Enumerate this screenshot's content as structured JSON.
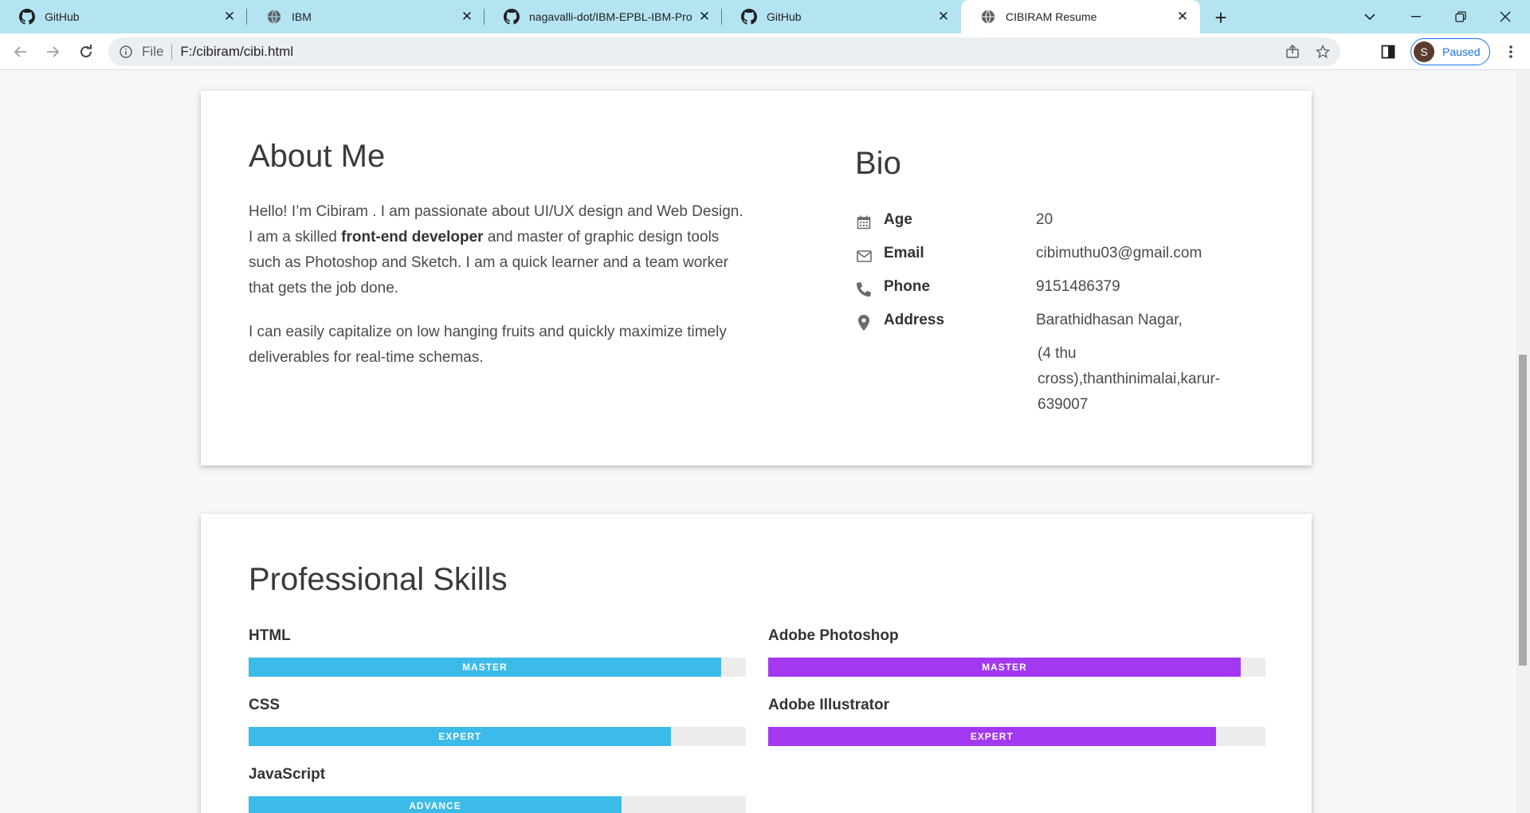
{
  "browser": {
    "tabs": [
      {
        "title": "GitHub",
        "icon": "github-icon",
        "active": false
      },
      {
        "title": "IBM",
        "icon": "globe-icon",
        "active": false
      },
      {
        "title": "nagavalli-dot/IBM-EPBL-IBM-Pro",
        "icon": "github-icon",
        "active": false
      },
      {
        "title": "GitHub",
        "icon": "github-icon",
        "active": false
      },
      {
        "title": "CIBIRAM Resume",
        "icon": "globe-icon",
        "active": true
      }
    ],
    "address": {
      "scheme": "File",
      "url": "F:/cibiram/cibi.html"
    },
    "profile": {
      "initial": "S",
      "status": "Paused"
    },
    "colors": {
      "tabstrip": "#b4e4f1",
      "accent": "#1a73e8"
    }
  },
  "about": {
    "title": "About Me",
    "p1_pre": "Hello! I’m Cibiram . I am passionate about UI/UX design and Web Design. I am a skilled ",
    "p1_bold": "front-end developer",
    "p1_post": " and master of graphic design tools such as Photoshop and Sketch. I am a quick learner and a team worker that gets the job done.",
    "p2": "I can easily capitalize on low hanging fruits and quickly maximize timely deliverables for real-time schemas."
  },
  "bio": {
    "title": "Bio",
    "rows": [
      {
        "label": "Age",
        "value": "20",
        "icon": "calendar-icon"
      },
      {
        "label": "Email",
        "value": "cibimuthu03@gmail.com",
        "icon": "envelope-icon"
      },
      {
        "label": "Phone",
        "value": "9151486379",
        "icon": "phone-icon"
      },
      {
        "label": "Address",
        "value": "Barathidhasan Nagar,",
        "icon": "map-marker-icon"
      }
    ],
    "address_extra": "(4 thu cross),thanthinimalai,karur-639007"
  },
  "skills": {
    "title": "Professional Skills",
    "colors": {
      "left": "#3cbbe8",
      "right": "#a238f0"
    },
    "items": [
      {
        "name": "HTML",
        "level": "MASTER",
        "percent": 95
      },
      {
        "name": "CSS",
        "level": "EXPERT",
        "percent": 85
      },
      {
        "name": "JavaScript",
        "level": "ADVANCE",
        "percent": 75
      },
      {
        "name": "Adobe Photoshop",
        "level": "MASTER",
        "percent": 95
      },
      {
        "name": "Adobe Illustrator",
        "level": "EXPERT",
        "percent": 90
      }
    ]
  }
}
